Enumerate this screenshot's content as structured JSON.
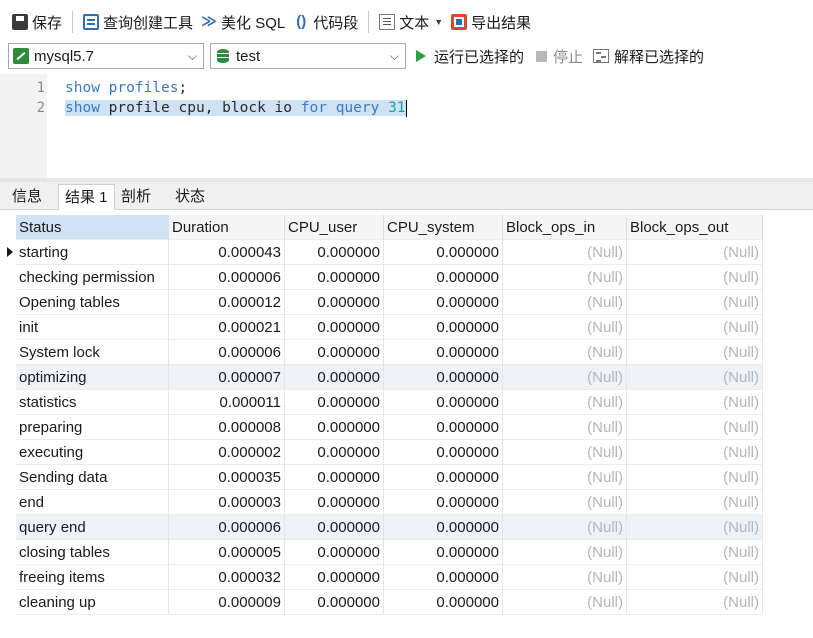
{
  "toolbar": {
    "save": "保存",
    "query_builder": "查询创建工具",
    "beautify": "美化 SQL",
    "snippet": "代码段",
    "text": "文本",
    "export": "导出结果"
  },
  "connection": {
    "selected": "mysql5.7"
  },
  "database": {
    "selected": "test"
  },
  "actions": {
    "run_selected": "运行已选择的",
    "stop": "停止",
    "explain_selected": "解释已选择的"
  },
  "editor": {
    "line_numbers": [
      "1",
      "2"
    ],
    "line1": {
      "kw1": "show",
      "kw2": "profiles",
      "punct": ";"
    },
    "line2": {
      "kw1": "show",
      "word1": "profile",
      "word2": "cpu,",
      "word3": "block",
      "word4": "io",
      "kw2": "for",
      "kw3": "query",
      "num": "31"
    }
  },
  "tabs": [
    "信息",
    "结果 1",
    "剖析",
    "状态"
  ],
  "active_tab": "结果 1",
  "grid": {
    "columns": [
      "Status",
      "Duration",
      "CPU_user",
      "CPU_system",
      "Block_ops_in",
      "Block_ops_out"
    ],
    "null_text": "(Null)",
    "rows": [
      [
        "starting",
        "0.000043",
        "0.000000",
        "0.000000"
      ],
      [
        "checking permission",
        "0.000006",
        "0.000000",
        "0.000000"
      ],
      [
        "Opening tables",
        "0.000012",
        "0.000000",
        "0.000000"
      ],
      [
        "init",
        "0.000021",
        "0.000000",
        "0.000000"
      ],
      [
        "System lock",
        "0.000006",
        "0.000000",
        "0.000000"
      ],
      [
        "optimizing",
        "0.000007",
        "0.000000",
        "0.000000"
      ],
      [
        "statistics",
        "0.000011",
        "0.000000",
        "0.000000"
      ],
      [
        "preparing",
        "0.000008",
        "0.000000",
        "0.000000"
      ],
      [
        "executing",
        "0.000002",
        "0.000000",
        "0.000000"
      ],
      [
        "Sending data",
        "0.000035",
        "0.000000",
        "0.000000"
      ],
      [
        "end",
        "0.000003",
        "0.000000",
        "0.000000"
      ],
      [
        "query end",
        "0.000006",
        "0.000000",
        "0.000000"
      ],
      [
        "closing tables",
        "0.000005",
        "0.000000",
        "0.000000"
      ],
      [
        "freeing items",
        "0.000032",
        "0.000000",
        "0.000000"
      ],
      [
        "cleaning up",
        "0.000009",
        "0.000000",
        "0.000000"
      ]
    ]
  },
  "colors": {
    "keyword": "#3a7ac2",
    "number": "#1ca09a",
    "selection": "#cfe2f3",
    "run_green": "#2ea043",
    "null_gray": "#b5b5b5"
  },
  "icons": [
    "save-icon",
    "query-builder-icon",
    "beautify-icon",
    "snippet-icon",
    "text-icon",
    "export-icon",
    "connection-icon",
    "database-icon",
    "play-icon",
    "stop-icon",
    "explain-icon"
  ]
}
